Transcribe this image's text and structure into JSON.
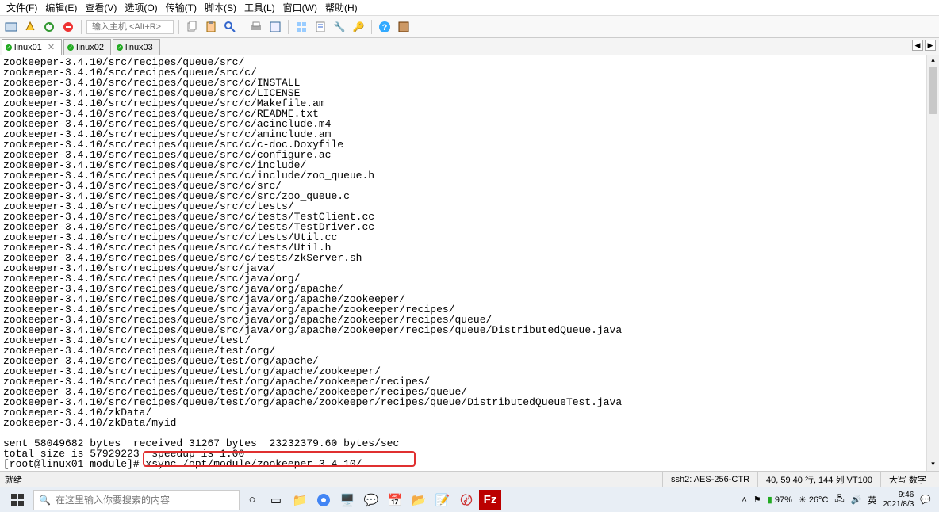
{
  "menu": {
    "items": [
      "文件(F)",
      "编辑(E)",
      "查看(V)",
      "选项(O)",
      "传输(T)",
      "脚本(S)",
      "工具(L)",
      "窗口(W)",
      "帮助(H)"
    ]
  },
  "toolbar": {
    "host_placeholder": "输入主机 <Alt+R>"
  },
  "tabs": {
    "items": [
      {
        "label": "linux01",
        "active": true,
        "closable": true
      },
      {
        "label": "linux02",
        "active": false,
        "closable": false
      },
      {
        "label": "linux03",
        "active": false,
        "closable": false
      }
    ]
  },
  "terminal": {
    "lines": [
      "zookeeper-3.4.10/src/recipes/queue/src/",
      "zookeeper-3.4.10/src/recipes/queue/src/c/",
      "zookeeper-3.4.10/src/recipes/queue/src/c/INSTALL",
      "zookeeper-3.4.10/src/recipes/queue/src/c/LICENSE",
      "zookeeper-3.4.10/src/recipes/queue/src/c/Makefile.am",
      "zookeeper-3.4.10/src/recipes/queue/src/c/README.txt",
      "zookeeper-3.4.10/src/recipes/queue/src/c/acinclude.m4",
      "zookeeper-3.4.10/src/recipes/queue/src/c/aminclude.am",
      "zookeeper-3.4.10/src/recipes/queue/src/c/c-doc.Doxyfile",
      "zookeeper-3.4.10/src/recipes/queue/src/c/configure.ac",
      "zookeeper-3.4.10/src/recipes/queue/src/c/include/",
      "zookeeper-3.4.10/src/recipes/queue/src/c/include/zoo_queue.h",
      "zookeeper-3.4.10/src/recipes/queue/src/c/src/",
      "zookeeper-3.4.10/src/recipes/queue/src/c/src/zoo_queue.c",
      "zookeeper-3.4.10/src/recipes/queue/src/c/tests/",
      "zookeeper-3.4.10/src/recipes/queue/src/c/tests/TestClient.cc",
      "zookeeper-3.4.10/src/recipes/queue/src/c/tests/TestDriver.cc",
      "zookeeper-3.4.10/src/recipes/queue/src/c/tests/Util.cc",
      "zookeeper-3.4.10/src/recipes/queue/src/c/tests/Util.h",
      "zookeeper-3.4.10/src/recipes/queue/src/c/tests/zkServer.sh",
      "zookeeper-3.4.10/src/recipes/queue/src/java/",
      "zookeeper-3.4.10/src/recipes/queue/src/java/org/",
      "zookeeper-3.4.10/src/recipes/queue/src/java/org/apache/",
      "zookeeper-3.4.10/src/recipes/queue/src/java/org/apache/zookeeper/",
      "zookeeper-3.4.10/src/recipes/queue/src/java/org/apache/zookeeper/recipes/",
      "zookeeper-3.4.10/src/recipes/queue/src/java/org/apache/zookeeper/recipes/queue/",
      "zookeeper-3.4.10/src/recipes/queue/src/java/org/apache/zookeeper/recipes/queue/DistributedQueue.java",
      "zookeeper-3.4.10/src/recipes/queue/test/",
      "zookeeper-3.4.10/src/recipes/queue/test/org/",
      "zookeeper-3.4.10/src/recipes/queue/test/org/apache/",
      "zookeeper-3.4.10/src/recipes/queue/test/org/apache/zookeeper/",
      "zookeeper-3.4.10/src/recipes/queue/test/org/apache/zookeeper/recipes/",
      "zookeeper-3.4.10/src/recipes/queue/test/org/apache/zookeeper/recipes/queue/",
      "zookeeper-3.4.10/src/recipes/queue/test/org/apache/zookeeper/recipes/queue/DistributedQueueTest.java",
      "zookeeper-3.4.10/zkData/",
      "zookeeper-3.4.10/zkData/myid",
      "",
      "sent 58049682 bytes  received 31267 bytes  23232379.60 bytes/sec",
      "total size is 57929223  speedup is 1.00",
      "[root@linux01 module]# xsync /opt/module/zookeeper-3.4.10/"
    ]
  },
  "statusbar": {
    "ready": "就绪",
    "conn": "ssh2: AES-256-CTR",
    "pos": "40, 59  40 行, 144 列 VT100",
    "caps": "大写 数字"
  },
  "taskbar": {
    "search_placeholder": "在这里输入你要搜索的内容",
    "battery": "97%",
    "temp": "26°C",
    "ime": "英",
    "time": "9:46",
    "date": "2021/8/3"
  }
}
